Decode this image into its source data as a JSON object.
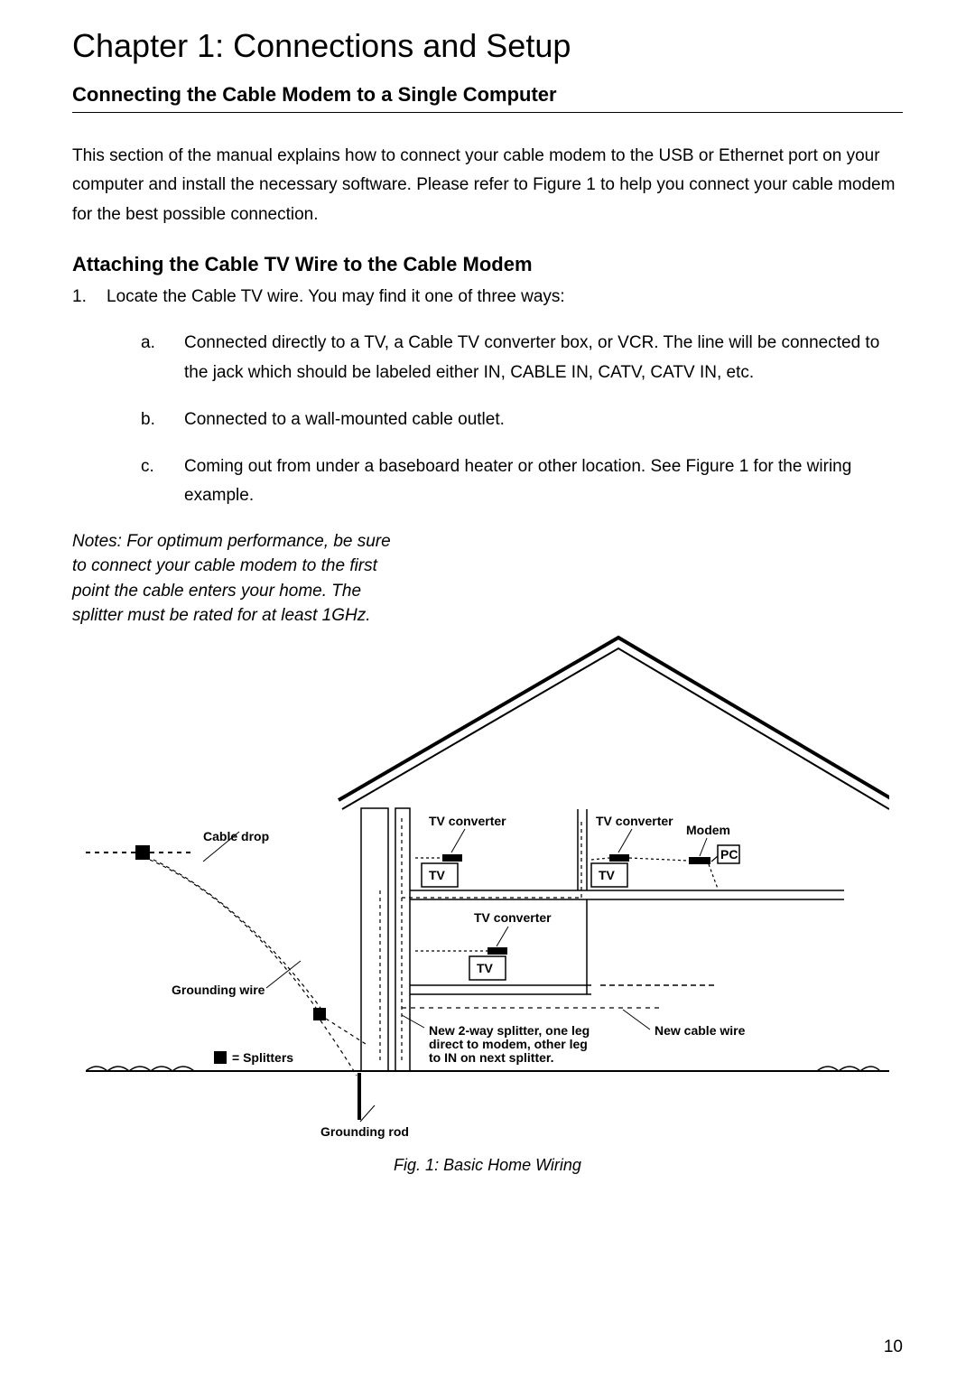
{
  "chapter_title": "Chapter 1: Connections and Setup",
  "section_heading": "Connecting the Cable Modem to a Single Computer",
  "intro_paragraph": "This section of the manual explains how to connect your cable modem to the USB or Ethernet port on your computer and install the necessary software.   Please refer to Figure 1 to help you connect your cable modem for the best possible connection.",
  "subheading": "Attaching the Cable TV Wire to the Cable Modem",
  "step1_num": "1.",
  "step1_text": "Locate the Cable TV wire. You may find it one of three ways:",
  "subitems": {
    "a_letter": "a.",
    "a_text": "Connected directly to a TV, a Cable TV converter box, or VCR. The line will be connected to the jack which should be labeled either IN, CABLE IN, CATV, CATV IN, etc.",
    "b_letter": "b.",
    "b_text": "Connected to a wall-mounted cable outlet.",
    "c_letter": "c.",
    "c_text": "Coming out from under a baseboard heater or other location. See Figure 1 for the wiring example."
  },
  "notes_label": "Notes:   For optimum performance, be sure to connect your cable modem to the first point the cable enters your home. The splitter must be rated for at least 1GHz.",
  "diagram": {
    "cable_drop": "Cable drop",
    "grounding_wire": "Grounding wire",
    "splitters": "= Splitters",
    "tv_converter": "TV converter",
    "tv": "TV",
    "modem": "Modem",
    "pc": "PC",
    "new_splitter_l1": "New 2-way splitter, one leg",
    "new_splitter_l2": "direct to modem, other leg",
    "new_splitter_l3": "to IN on next splitter.",
    "new_cable_wire": "New cable wire",
    "grounding_rod": "Grounding rod"
  },
  "figure_caption": "Fig. 1:   Basic Home Wiring",
  "page_number": "10"
}
